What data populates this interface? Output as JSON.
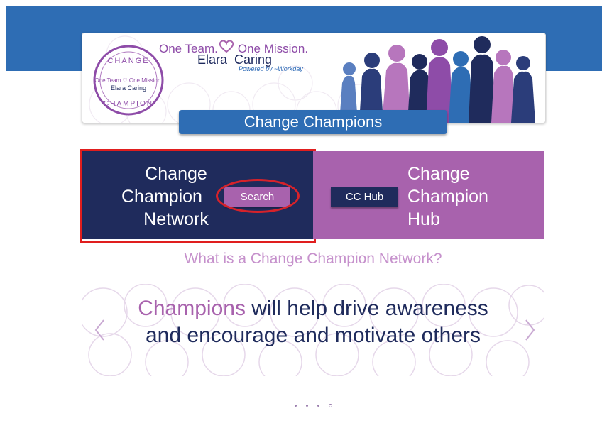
{
  "banner": {
    "tagline_left": "One Team.",
    "tagline_right": "One Mission.",
    "brand_left": "Elara",
    "brand_right": "Caring",
    "powered_by": "Powered by",
    "workday": "Workday",
    "badge_top": "CHANGE",
    "badge_bottom": "CHAMPION",
    "title": "Change Champions"
  },
  "panels": {
    "left_title_lines": [
      "Change",
      "Champion",
      "Network"
    ],
    "search_label": "Search",
    "right_title_lines": [
      "Change",
      "Champion",
      "Hub"
    ],
    "cchub_label": "CC Hub"
  },
  "question": "What is a Change Champion Network?",
  "carousel": {
    "highlight": "Champions",
    "line1_rest": " will help drive awareness",
    "line2": "and encourage and motivate others",
    "prev_icon": "chevron-left-icon",
    "next_icon": "chevron-right-icon",
    "slide_count": 4,
    "active_index": 3
  },
  "colors": {
    "topbar": "#2e6db4",
    "navy": "#1f2b5c",
    "purple": "#a862ad",
    "highlight_red": "#e01e1e"
  }
}
